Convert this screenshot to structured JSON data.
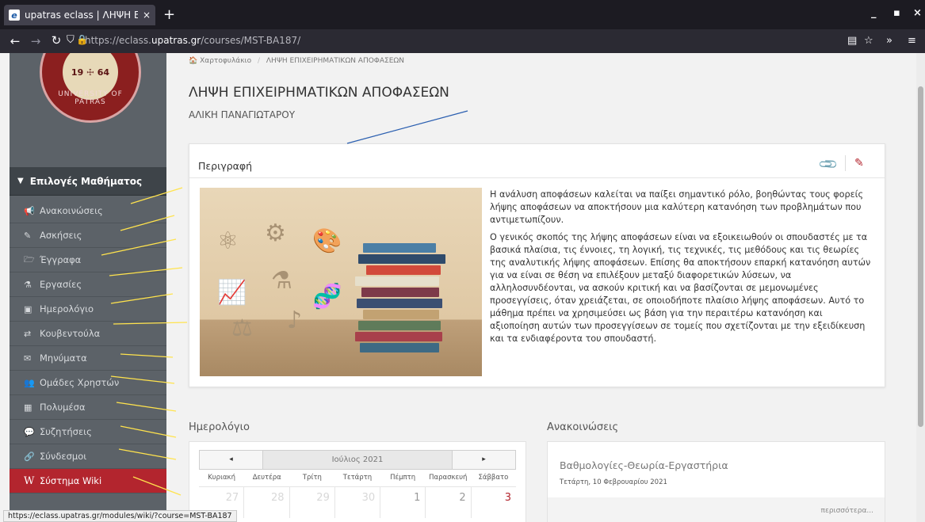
{
  "browser": {
    "tab_title": "upatras eclass | ΛΗΨΗ ΕΠΙΧΕΙ",
    "tab_close": "×",
    "new_tab": "+",
    "url_prefix": "https://eclass.",
    "url_domain": "upatras.gr",
    "url_path": "/courses/MST-BA187/",
    "status_url": "https://eclass.upatras.gr/modules/wiki/?course=MST-BA187"
  },
  "logo": {
    "year_text": "19 ☩ 64",
    "ring_text": "UNIVERSITY OF PATRAS"
  },
  "sidebar": {
    "header": "Επιλογές Μαθήματος",
    "items": [
      {
        "label": "Ανακοινώσεις",
        "icon": "megaphone-icon",
        "glyph": "📢"
      },
      {
        "label": "Ασκήσεις",
        "icon": "edit-icon",
        "glyph": "✎"
      },
      {
        "label": "Έγγραφα",
        "icon": "folder-icon",
        "glyph": "🗁"
      },
      {
        "label": "Εργασίες",
        "icon": "flask-icon",
        "glyph": "⚗"
      },
      {
        "label": "Ημερολόγιο",
        "icon": "calendar-icon",
        "glyph": "▣"
      },
      {
        "label": "Κουβεντούλα",
        "icon": "exchange-icon",
        "glyph": "⇄"
      },
      {
        "label": "Μηνύματα",
        "icon": "envelope-icon",
        "glyph": "✉"
      },
      {
        "label": "Ομάδες Χρηστών",
        "icon": "users-icon",
        "glyph": "👥"
      },
      {
        "label": "Πολυμέσα",
        "icon": "film-icon",
        "glyph": "▦"
      },
      {
        "label": "Συζητήσεις",
        "icon": "comments-icon",
        "glyph": "💬"
      },
      {
        "label": "Σύνδεσμοι",
        "icon": "link-icon",
        "glyph": "🔗"
      },
      {
        "label": "Σύστημα Wiki",
        "icon": "wiki-icon",
        "glyph": "W"
      }
    ]
  },
  "breadcrumb": {
    "home": "Χαρτοφυλάκιο",
    "separator": "/",
    "current": "ΛΗΨΗ ΕΠΙΧΕΙΡΗΜΑΤΙΚΩΝ ΑΠΟΦΑΣΕΩΝ"
  },
  "course": {
    "title": "ΛΗΨΗ ΕΠΙΧΕΙΡΗΜΑΤΙΚΩΝ ΑΠΟΦΑΣΕΩΝ",
    "instructor": "ΑΛΙΚΗ ΠΑΝΑΓΙΩΤΑΡΟΥ"
  },
  "description": {
    "heading": "Περιγραφή",
    "paragraph1": "Η ανάλυση αποφάσεων καλείται να παίξει σημαντικό ρόλο, βοηθώντας τους φορείς λήψης αποφάσεων να αποκτήσουν μια καλύτερη κατανόηση των προβλημάτων που αντιμετωπίζουν.",
    "paragraph2": "Ο γενικός σκοπός της λήψης αποφάσεων είναι να εξοικειωθούν οι σπουδαστές με τα βασικά πλαίσια, τις έννοιες, τη λογική, τις τεχνικές, τις μεθόδους και τις θεωρίες της αναλυτικής λήψης αποφάσεων. Επίσης θα αποκτήσουν επαρκή κατανόηση αυτών για να είναι σε θέση να επιλέξουν μεταξύ διαφορετικών λύσεων, να αλληλοσυνδέονται, να ασκούν κριτική και να βασίζονται σε μεμονωμένες προσεγγίσεις, όταν χρειάζεται, σε οποιοδήποτε πλαίσιο λήψης αποφάσεων. Αυτό το μάθημα πρέπει να χρησιμεύσει ως βάση για την περαιτέρω κατανόηση και αξιοποίηση αυτών των προσεγγίσεων σε τομείς που σχετίζονται με την εξειδίκευση και τα ενδιαφέροντα του σπουδαστή."
  },
  "calendar": {
    "heading": "Ημερολόγιο",
    "month": "Ιούλιος 2021",
    "prev": "◂",
    "next": "▸",
    "weekdays": [
      "Κυριακή",
      "Δευτέρα",
      "Τρίτη",
      "Τετάρτη",
      "Πέμπτη",
      "Παρασκευή",
      "Σάββατο"
    ],
    "first_row": [
      "27",
      "28",
      "29",
      "30",
      "1",
      "2",
      "3"
    ]
  },
  "announcements": {
    "heading": "Ανακοινώσεις",
    "item_title": "Βαθμολογίες-Θεωρία-Εργαστήρια",
    "item_date": "Τετάρτη, 10 Φεβρουαρίου 2021",
    "more": "περισσότερα..."
  },
  "colors": {
    "sidebar_bg": "#5c6268",
    "active_item": "#b3252e",
    "annotation_yellow": "#ffe34d",
    "annotation_blue": "#2b5fb0"
  }
}
